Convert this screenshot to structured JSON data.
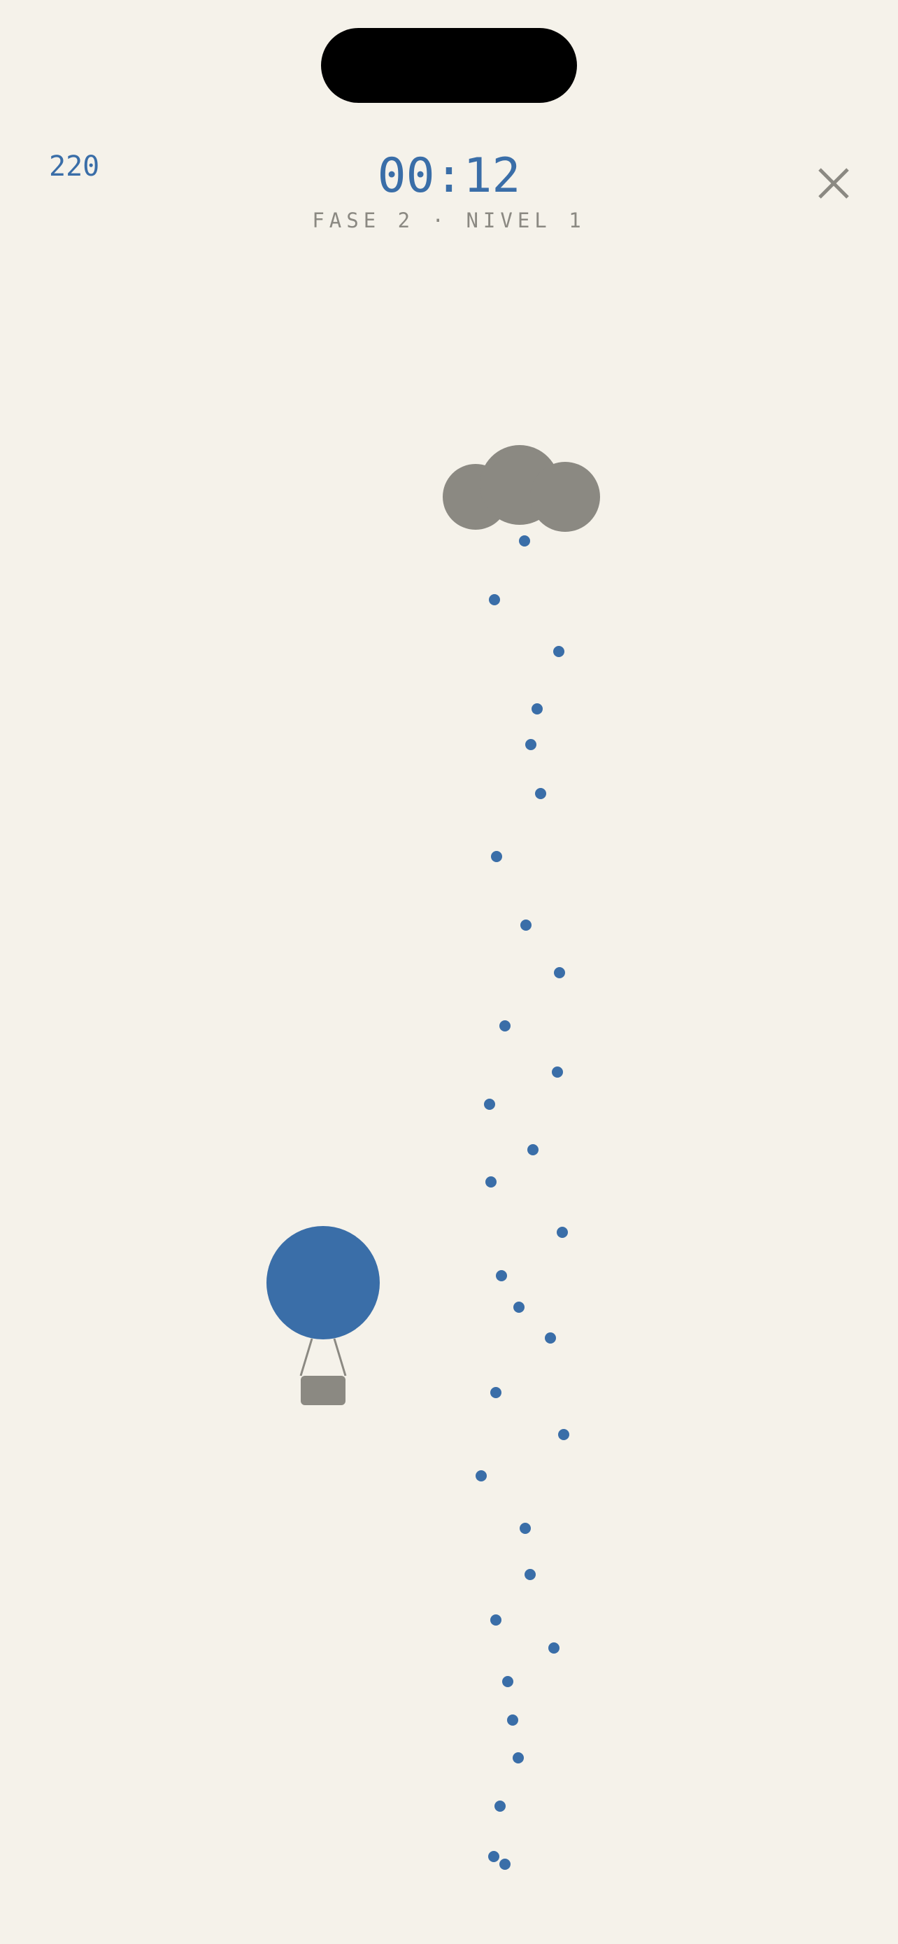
{
  "hud": {
    "score": "220",
    "timer": "00:12",
    "phase_label": "FASE 2 · NIVEL 1"
  },
  "icons": {
    "close": "close-icon",
    "cloud": "cloud-icon",
    "balloon": "balloon-icon"
  },
  "colors": {
    "background": "#f5f2ea",
    "accent": "#3a6ea8",
    "muted": "#8b8982",
    "island": "#000000"
  }
}
